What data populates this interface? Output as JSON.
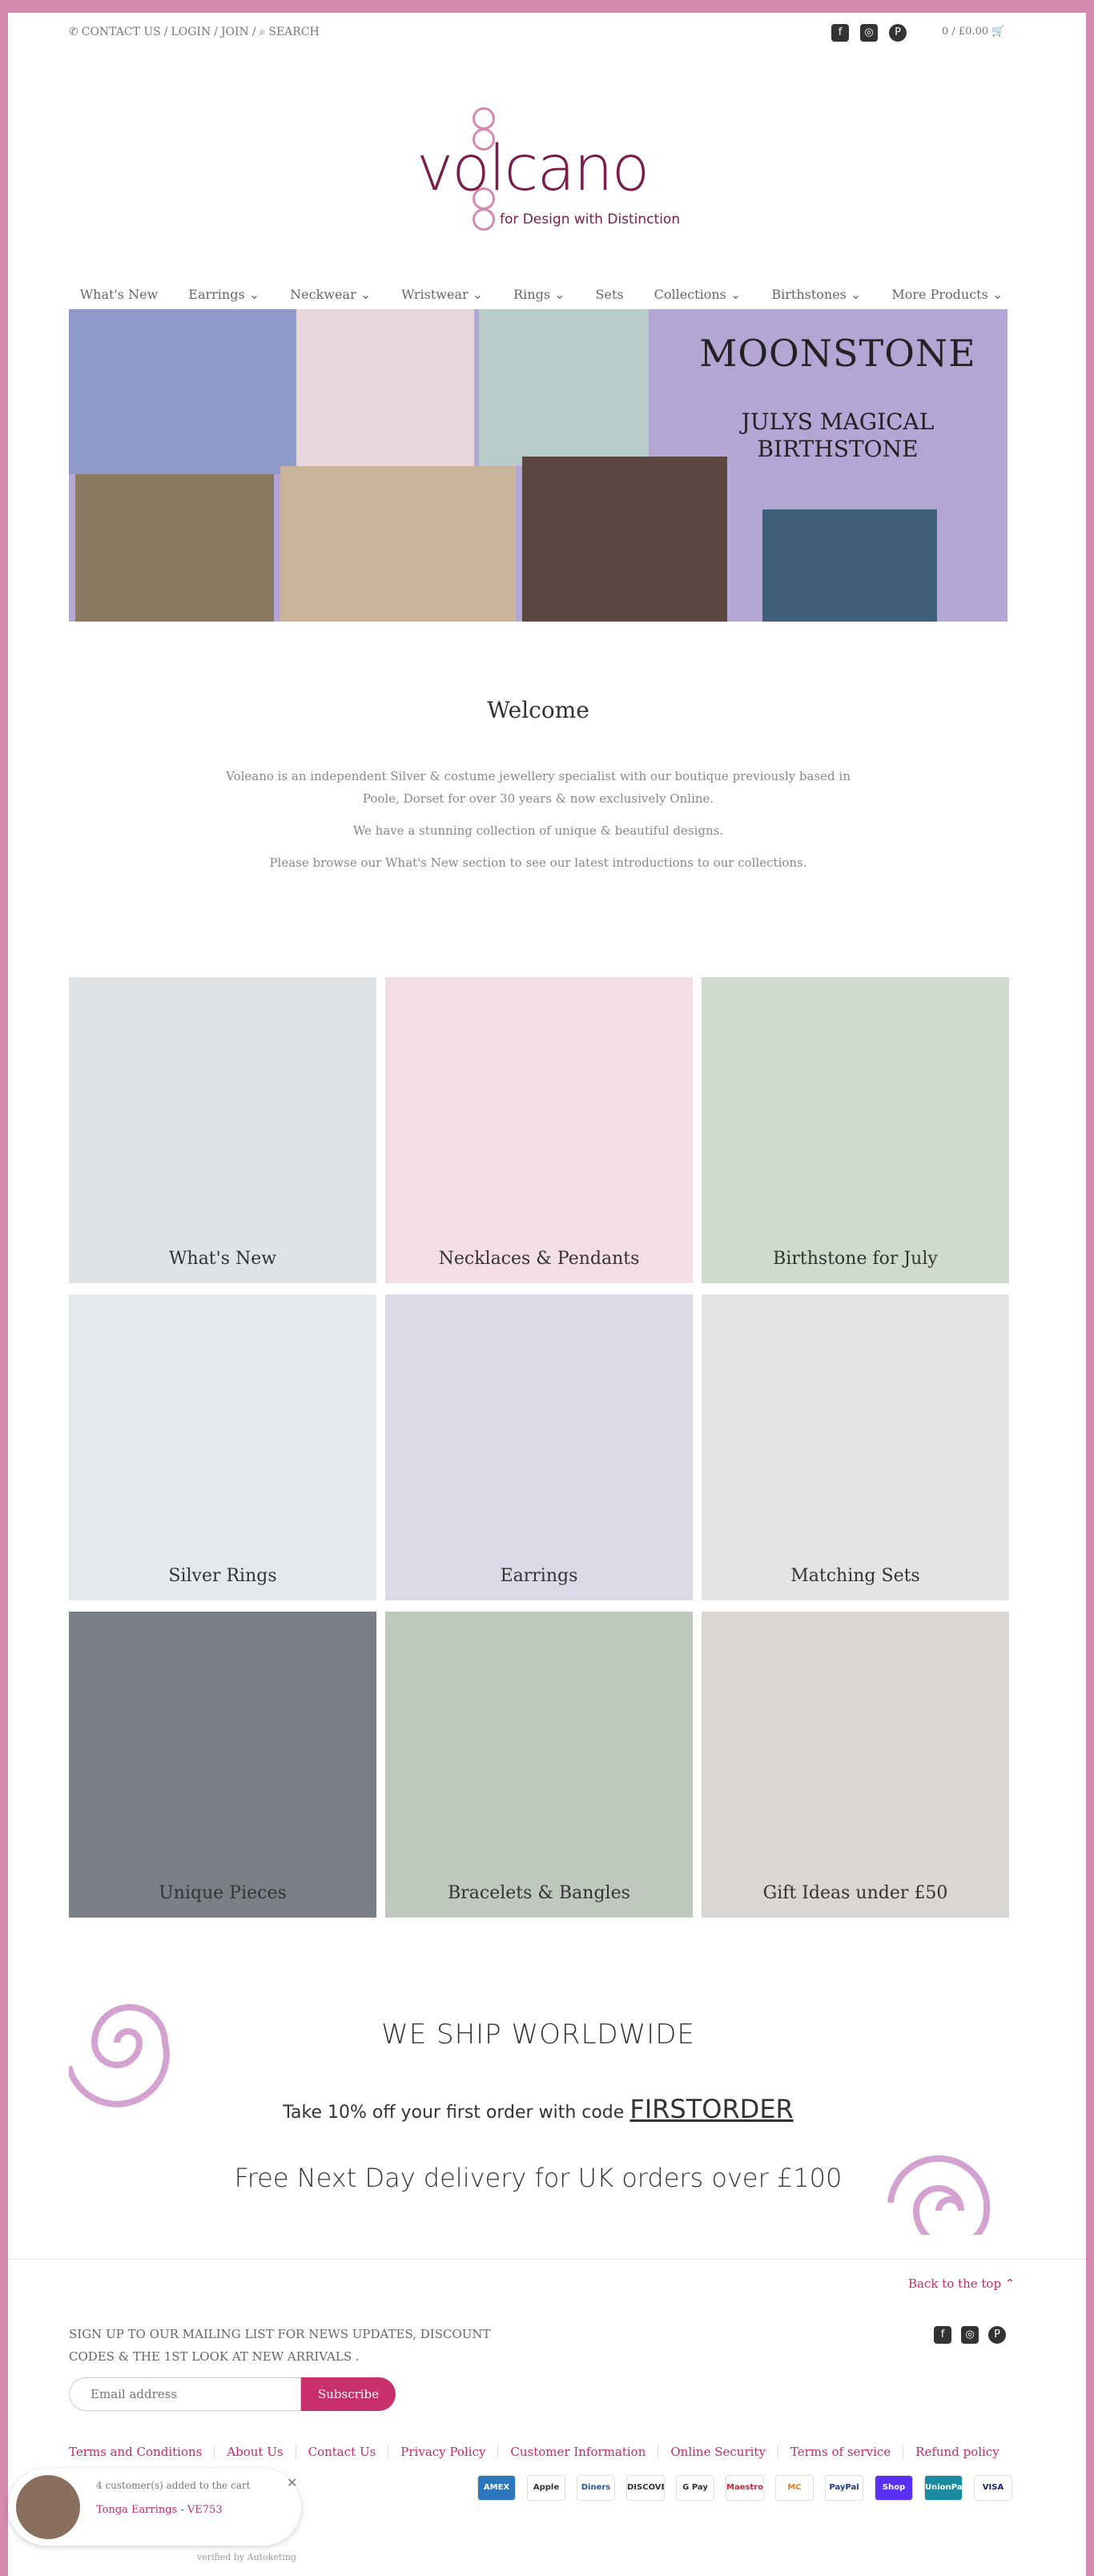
{
  "topbar": {
    "contact": "CONTACT US",
    "login": "LOGIN",
    "join": "JOIN",
    "search": "SEARCH",
    "sep": "/",
    "cart": "0 / £0.00"
  },
  "logo": {
    "text": "volcano",
    "tagline": "for Design with Distinction"
  },
  "nav": [
    "What's New",
    "Earrings",
    "Neckwear",
    "Wristwear",
    "Rings",
    "Sets",
    "Collections",
    "Birthstones",
    "More Products"
  ],
  "hero": {
    "title": "MOONSTONE",
    "subtitle": "JULYS MAGICAL BIRTHSTONE"
  },
  "welcome": {
    "title": "Welcome",
    "p1": "Voleano is an independent Silver & costume jewellery specialist with our boutique previously based in Poole, Dorset for over 30 years & now exclusively Online.",
    "p2": "We have a stunning collection of unique & beautiful designs.",
    "p3": "Please browse our What's New section to see our latest introductions to our collections."
  },
  "tiles": [
    "What's New",
    "Necklaces & Pendants",
    "Birthstone for July",
    "Silver Rings",
    "Earrings",
    "Matching Sets",
    "Unique Pieces",
    "Bracelets & Bangles",
    "Gift Ideas under £50"
  ],
  "shipping": {
    "heading": "WE SHIP WORLDWIDE",
    "offer": "Take 10% off your first order with code",
    "code": "FIRSTORDER",
    "delivery": "Free Next Day delivery for UK orders over £100"
  },
  "footer": {
    "back_to_top": "Back to the top ⌃",
    "mailing": "SIGN UP TO OUR MAILING LIST FOR NEWS UPDATES, DISCOUNT CODES & THE 1ST LOOK AT NEW ARRIVALS .",
    "email_placeholder": "Email address",
    "subscribe": "Subscribe",
    "links": [
      "Terms and Conditions",
      "About Us",
      "Contact Us",
      "Privacy Policy",
      "Customer Information",
      "Online Security",
      "Terms of service",
      "Refund policy"
    ],
    "payments": [
      "AMEX",
      "Apple Pay",
      "Diners",
      "DISCOVER",
      "G Pay",
      "Maestro",
      "MC",
      "PayPal",
      "Shop Pay",
      "UnionPay",
      "VISA"
    ]
  },
  "popup": {
    "added": "4 customer(s) added to the cart",
    "product": "Tonga Earrings - VE753"
  },
  "verified": "verified by Autoketing"
}
